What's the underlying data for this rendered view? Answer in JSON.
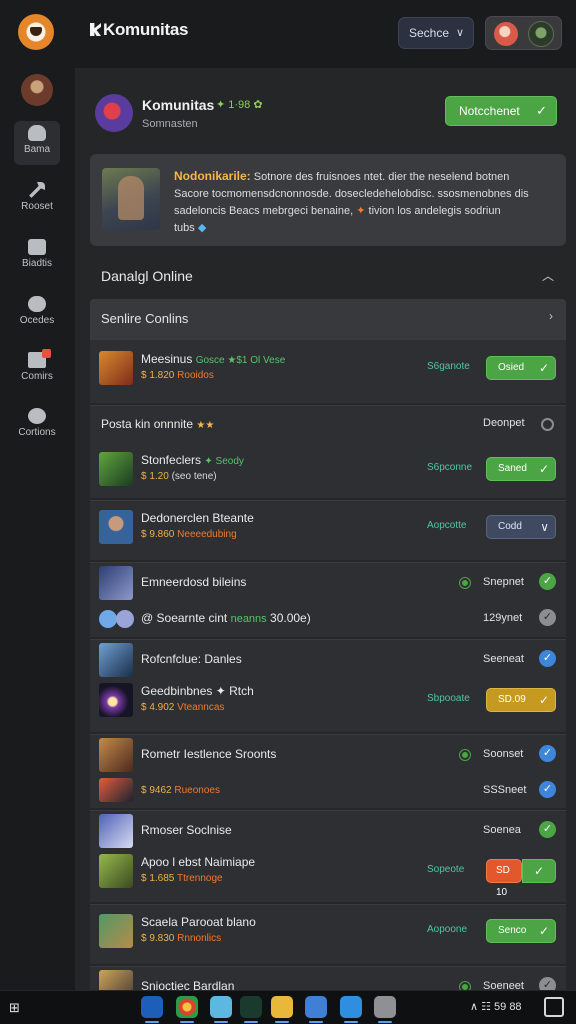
{
  "topbar": {
    "app_title": "Komunitas",
    "search_label": "Sechce",
    "search_icon_glyph": "∨"
  },
  "sidebar": {
    "items": [
      {
        "label": "Bama",
        "icon": "game-controller-icon",
        "active": true
      },
      {
        "label": "Rooset",
        "icon": "tools-icon",
        "active": false
      },
      {
        "label": "Biadtis",
        "icon": "chat-icon",
        "active": false
      },
      {
        "label": "Ocedes",
        "icon": "shield-icon",
        "active": false
      },
      {
        "label": "Comirs",
        "icon": "flag-icon",
        "active": false
      },
      {
        "label": "Cortions",
        "icon": "bubble-icon",
        "active": false
      }
    ]
  },
  "community": {
    "name": "Komunitas",
    "stats": "✦ 1·98 ✿",
    "subtitle": "Somnasten",
    "notify_button": "Notcchenet"
  },
  "banner": {
    "headline": "Nodonikarile:",
    "line1": " Sotnore des fruisnoes ntet. dier the neselend botnen",
    "line2": "Sacore tocmomensdcnonnosde. dosecledehelobdisc. ssosmenobnes dis",
    "line3": "sadeloncis Beacs mebrgeci benaine,",
    "line3_highlight": " tivion los andelegis sodriun",
    "line4": "tubs"
  },
  "section": {
    "title": "Danalgl Online"
  },
  "online_header": {
    "title": "Senlire Conlins"
  },
  "rows": {
    "r1": {
      "title": "Meesinus",
      "title_extra": "Gosce ★$1 Ol Vese",
      "sub": "$ 1.820",
      "sub_extra": "Rooidos",
      "meta": "S6ganote",
      "action": "Osied"
    },
    "r2": {
      "title": "Posta kin onnnite",
      "title_extra": "★★",
      "status": "Deonpet"
    },
    "r3": {
      "title": "Stonfeclers",
      "title_extra": "✦ Seody",
      "sub": "$ 1.20",
      "sub_extra": "(seo tene)",
      "meta": "S6pconne",
      "action": "Saned"
    },
    "r4": {
      "title": "Dedonerclen Bteante",
      "sub": "$ 9.860",
      "sub_extra": "Neeeedubing",
      "meta": "Aopcotte",
      "action": "Codd"
    },
    "r5": {
      "title": "Emneerdosd bileins",
      "status": "Snepnet"
    },
    "r6": {
      "title": "@ Soearnte cint",
      "title_extra": "neanns",
      "title_tail": "30.00e)",
      "status": "129ynet"
    },
    "r7": {
      "title": "Rofcnfclue: Danles",
      "status": "Seeneat"
    },
    "r8": {
      "title": "Geedbinbnes",
      "title_extra": "✦ Rtch",
      "sub": "$ 4.902",
      "sub_extra": "Vteanncas",
      "meta": "Sbpooate",
      "action": "SD.09"
    },
    "r9": {
      "title": "Rometr Iestlence Sroonts",
      "status": "Soonset"
    },
    "r10": {
      "title": "",
      "sub": "$ 9462",
      "sub_extra": "Rueonoes",
      "status": "SSSneet"
    },
    "r11": {
      "title": "Rmoser Soclnise",
      "status": "Soenea"
    },
    "r12": {
      "title": "Apoo l ebst Naimiape",
      "sub": "$ 1.685",
      "sub_extra": "Ttrennoge",
      "meta": "Sopeote",
      "action": "SD 10"
    },
    "r13": {
      "title": "Scaela Parooat blano",
      "sub": "$ 9.830",
      "sub_extra": "Rnnonlics",
      "meta": "Aopoone",
      "action": "Senco"
    },
    "r14": {
      "title": "Snioctiec Bardlan",
      "status": "Soeneet"
    }
  },
  "taskbar": {
    "tray_text": "∧ ☷ 59 88"
  },
  "colors": {
    "accent_green": "#4ca545",
    "accent_blue": "#3d86dc",
    "highlight_orange": "#f07a2e",
    "gold": "#f5b64b"
  }
}
